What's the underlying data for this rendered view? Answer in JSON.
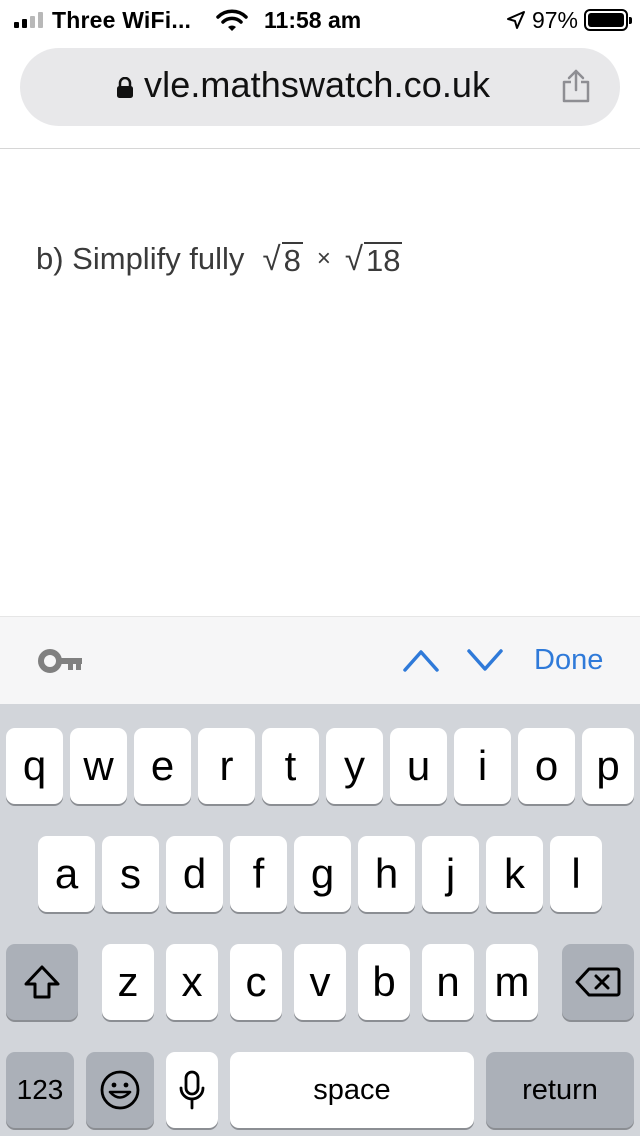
{
  "status_bar": {
    "carrier": "Three WiFi...",
    "time": "11:58 am",
    "battery": "97%"
  },
  "address_bar": {
    "url": "vle.mathswatch.co.uk"
  },
  "question": {
    "label": "b) Simplify fully",
    "radicand_1": "8",
    "operator": "×",
    "radicand_2": "18"
  },
  "accessory_bar": {
    "done_label": "Done"
  },
  "keyboard": {
    "row1": [
      "q",
      "w",
      "e",
      "r",
      "t",
      "y",
      "u",
      "i",
      "o",
      "p"
    ],
    "row2": [
      "a",
      "s",
      "d",
      "f",
      "g",
      "h",
      "j",
      "k",
      "l"
    ],
    "row3": [
      "z",
      "x",
      "c",
      "v",
      "b",
      "n",
      "m"
    ],
    "numbers_label": "123",
    "space_label": "space",
    "return_label": "return"
  },
  "colors": {
    "accent": "#2f7ad9",
    "keyboard_bg": "#d2d5da",
    "key_bg": "#ffffff",
    "key_dark_bg": "#abb0b8",
    "address_bg": "#e8e8ea"
  }
}
